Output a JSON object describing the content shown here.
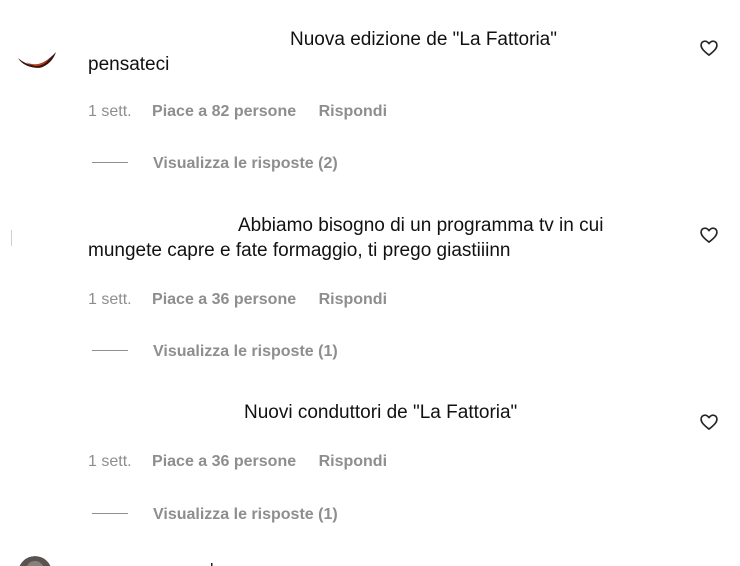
{
  "comments": [
    {
      "text_line1": "Nuova edizione de \"La Fattoria\"",
      "text_line2": "pensateci",
      "time": "1 sett.",
      "likes": "Piace a 82 persone",
      "reply": "Rispondi",
      "view_replies": "Visualizza le risposte (2)",
      "heart_icon": "heart-outline-icon"
    },
    {
      "text_line1": "Abbiamo bisogno di un programma tv in cui",
      "text_line2": "mungete capre e fate formaggio, ti prego giastiiinn",
      "time": "1 sett.",
      "likes": "Piace a 36 persone",
      "reply": "Rispondi",
      "view_replies": "Visualizza le risposte (1)",
      "heart_icon": "heart-outline-icon"
    },
    {
      "text_line1": "Nuovi conduttori de \"La Fattoria\"",
      "time": "1 sett.",
      "likes": "Piace a 36 persone",
      "reply": "Rispondi",
      "view_replies": "Visualizza le risposte (1)",
      "heart_icon": "heart-outline-icon"
    }
  ],
  "colors": {
    "text": "#111111",
    "meta": "#8e8e8e",
    "background": "#ffffff"
  }
}
